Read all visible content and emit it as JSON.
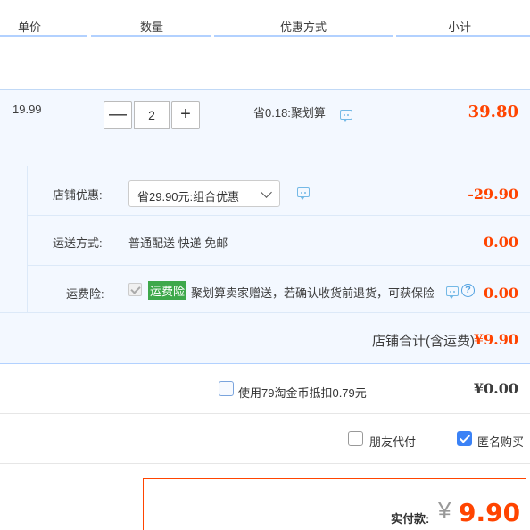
{
  "header": {
    "col_price": "单价",
    "col_qty": "数量",
    "col_promo": "优惠方式",
    "col_subtotal": "小计"
  },
  "item": {
    "price": "19.99",
    "quantity": "2",
    "minus_label": "—",
    "plus_label": "+",
    "promo": "省0.18:聚划算",
    "subtotal": "39.80"
  },
  "shop": {
    "discount_label": "店铺优惠:",
    "discount_select": "省29.90元:组合优惠",
    "discount_amount": "-29.90",
    "shipping_label": "运送方式:",
    "shipping_value": "普通配送 快递 免邮",
    "shipping_amount": "0.00",
    "insurance_label": "运费险:",
    "insurance_badge": "运费险",
    "insurance_text": "聚划算卖家赠送，若确认收货前退货，可获保险赔付",
    "insurance_help": "?",
    "insurance_amount": "0.00",
    "total_label": "店铺合计(含运费)",
    "total_amount": "¥9.90"
  },
  "coins": {
    "label": "使用79淘金币抵扣0.79元",
    "amount": "¥0.00"
  },
  "options": {
    "friend_pay": "朋友代付",
    "anonymous": "匿名购买",
    "anonymous_checked": true
  },
  "payment": {
    "label": "实付款:",
    "currency": "¥",
    "amount": "9.90"
  },
  "colors": {
    "accent": "#ff4400",
    "highlight_bg": "#f3f8ff",
    "badge_green": "#3ea84b",
    "checkbox_blue": "#3b82f6"
  }
}
